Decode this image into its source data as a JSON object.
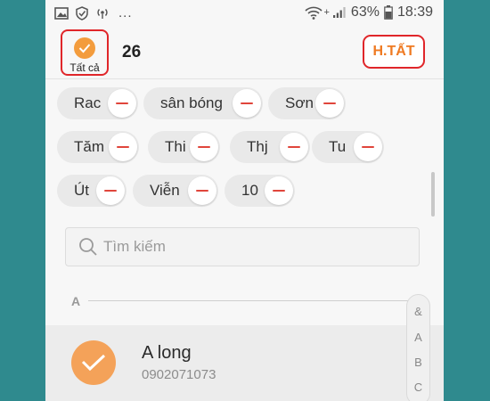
{
  "status_bar": {
    "overflow": "...",
    "signal_plus": "+",
    "battery": "63%",
    "time": "18:39"
  },
  "header": {
    "select_all_label": "Tất cả",
    "selected_count": "26",
    "cancel_label": "H.TẤT"
  },
  "chips": [
    "Rac",
    "sân bóng",
    "Sơn",
    "Tăm",
    "Thi",
    "Thj",
    "Tu",
    "Út",
    "Viễn",
    "10"
  ],
  "search": {
    "placeholder": "Tìm kiếm"
  },
  "section": {
    "letter": "A"
  },
  "index": [
    "&",
    "A",
    "B",
    "C"
  ],
  "contact": {
    "name": "A long",
    "phone": "0902071073",
    "selected": true
  },
  "colors": {
    "accent_orange": "#f39c3d",
    "highlight_red": "#e0262a",
    "background_teal": "#2f8a8e"
  }
}
